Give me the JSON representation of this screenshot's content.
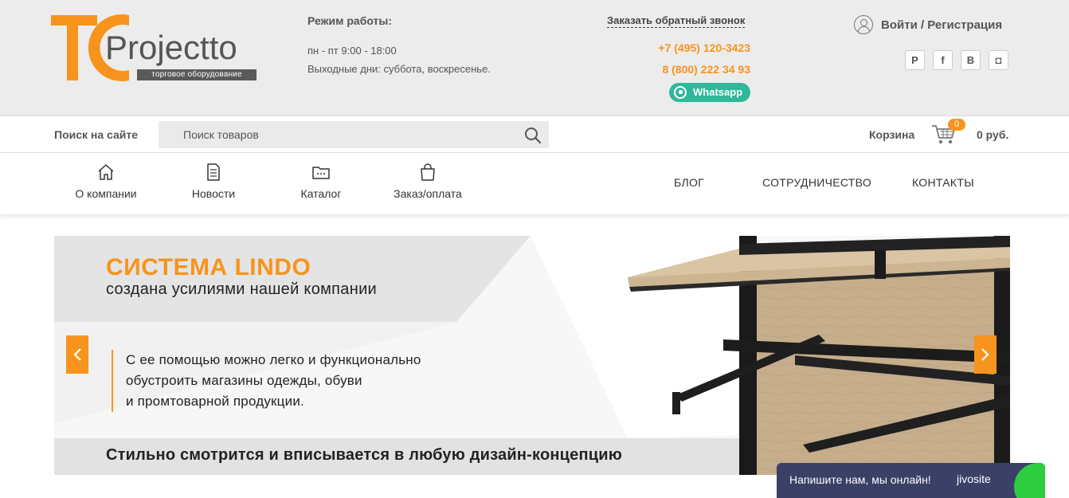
{
  "header": {
    "logo": {
      "main": "Projectto",
      "tagline": "торговое оборудование"
    },
    "hours": {
      "title": "Режим работы:",
      "weekdays": "пн - пт 9:00 - 18:00",
      "weekends": "Выходные дни: суббота, воскресенье."
    },
    "contacts": {
      "callback": "Заказать обратный звонок",
      "phone1": "+7 (495) 120-3423",
      "phone2": "8 (800) 222 34 93",
      "whatsapp": "Whatsapp"
    },
    "account": {
      "login": "Войти / Регистрация"
    },
    "socials": [
      {
        "icon": "pinterest-icon",
        "glyph": "P"
      },
      {
        "icon": "facebook-icon",
        "glyph": "f"
      },
      {
        "icon": "vk-icon",
        "glyph": "B"
      },
      {
        "icon": "instagram-icon",
        "glyph": "◘"
      }
    ]
  },
  "search": {
    "label": "Поиск на сайте",
    "placeholder": "Поиск товаров"
  },
  "cart": {
    "label": "Корзина",
    "count": "0",
    "sum": "0 руб."
  },
  "nav": {
    "icon_items": [
      {
        "label": "О компании",
        "icon": "home-icon"
      },
      {
        "label": "Новости",
        "icon": "document-icon"
      },
      {
        "label": "Каталог",
        "icon": "folder-icon"
      },
      {
        "label": "Заказ/оплата",
        "icon": "shopping-bag-icon"
      }
    ],
    "links": [
      "БЛОГ",
      "СОТРУДНИЧЕСТВО",
      "КОНТАКТЫ"
    ]
  },
  "slider": {
    "title": "СИСТЕМА LINDO",
    "subtitle": "создана усилиями нашей компании",
    "body": [
      "С ее помощью можно легко и функционально",
      "обустроить магазины одежды, обуви",
      "и промтоварной продукции."
    ],
    "footer": "Стильно смотрится и вписывается в любую дизайн-концепцию"
  },
  "chat": {
    "text": "Напишите нам, мы онлайн!",
    "brand": "jivosite"
  },
  "colors": {
    "accent": "#f7941d",
    "whatsapp": "#2fb89a",
    "chat": "#3a4066"
  }
}
